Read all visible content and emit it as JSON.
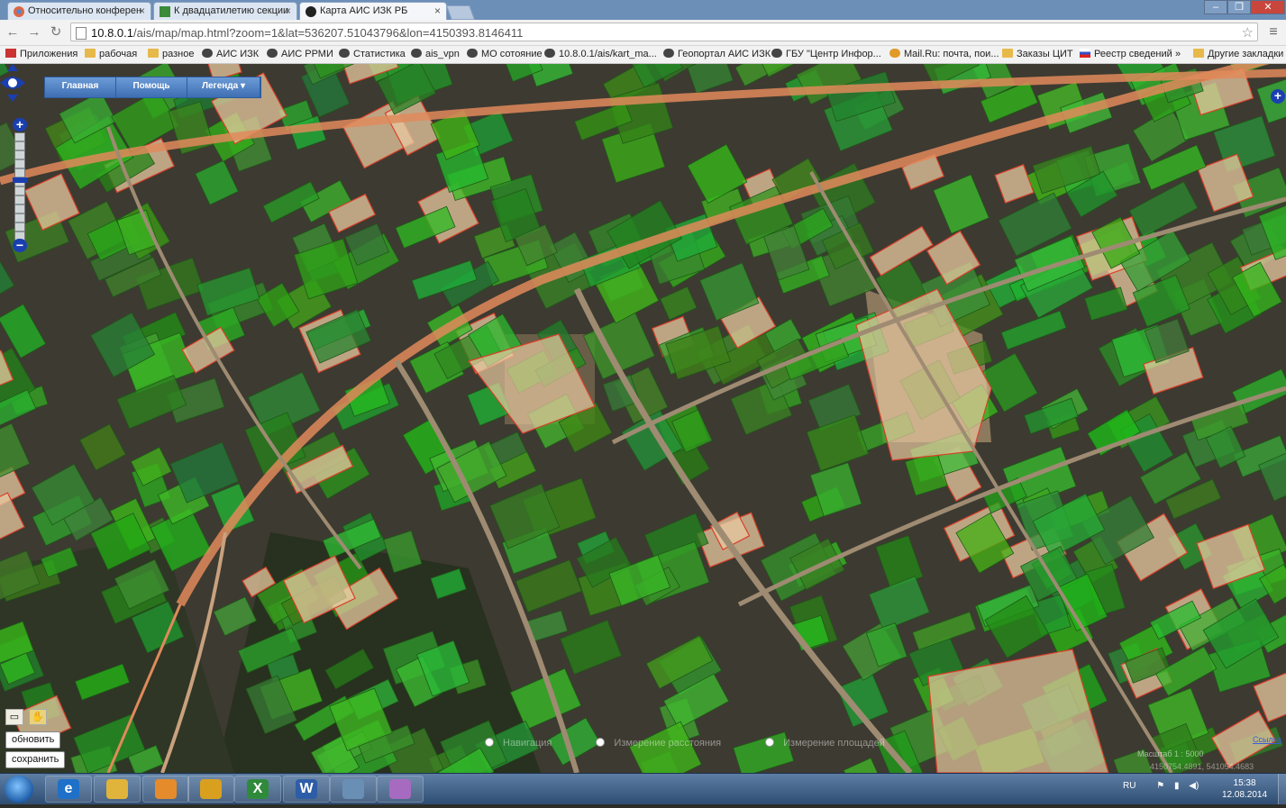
{
  "browser": {
    "tabs": [
      {
        "label": "Относительно конферен"
      },
      {
        "label": "К двадцатилетию секции"
      },
      {
        "label": "Карта АИС ИЗК РБ"
      }
    ],
    "url_host": "10.8.0.1",
    "url_path": "/ais/map/map.html?zoom=1&lat=536207.51043796&lon=4150393.8146411",
    "bookmarks": [
      {
        "label": "Приложения",
        "icon": "apps-icon"
      },
      {
        "label": "рабочая",
        "icon": "folder-icon"
      },
      {
        "label": "разное",
        "icon": "folder-icon"
      },
      {
        "label": "АИС ИЗК",
        "icon": "page-icon"
      },
      {
        "label": "АИС РРМИ",
        "icon": "page-icon"
      },
      {
        "label": "Статистика",
        "icon": "page-icon"
      },
      {
        "label": "ais_vpn",
        "icon": "page-icon"
      },
      {
        "label": "МО сотоя­ние",
        "icon": "page-icon"
      },
      {
        "label": "10.8.0.1/ais/kart_ma...",
        "icon": "page-icon"
      },
      {
        "label": "Геопортал АИС ИЗК",
        "icon": "page-icon"
      },
      {
        "label": "ГБУ \"Центр Инфор...",
        "icon": "page-icon"
      },
      {
        "label": "Mail.Ru: почта, пои...",
        "icon": "mail-icon"
      },
      {
        "label": "Заказы ЦИТ",
        "icon": "folder-icon"
      },
      {
        "label": "Реестр сведений",
        "icon": "flag-icon"
      },
      {
        "label": "»",
        "icon": ""
      },
      {
        "label": "Другие закладки",
        "icon": "folder-icon"
      }
    ]
  },
  "map": {
    "menu": [
      {
        "label": "Главная"
      },
      {
        "label": "Помощь"
      },
      {
        "label": "Легенда"
      }
    ],
    "buttons": {
      "refresh": "обновить",
      "save": "сохранить"
    },
    "modes": [
      {
        "label": "Навигация"
      },
      {
        "label": "Измерение расстояния"
      },
      {
        "label": "Измерение площадей"
      }
    ],
    "scale_text": "Масштаб 1 : 5000",
    "coords_text": "4150754.4891, 541054.4683",
    "credits": "Ссылка",
    "colors": {
      "parcel_green": "#2fa52a",
      "parcel_tan": "#e8c9a0",
      "road": "#e08a5a",
      "boundary": "#d9402a"
    }
  },
  "taskbar": {
    "apps": [
      "ie-icon",
      "explorer-icon",
      "media-player-icon",
      "chrome-icon",
      "excel-icon",
      "word-icon",
      "window-icon",
      "paint-icon"
    ],
    "app_letters": [
      "e",
      "",
      "",
      "",
      "X",
      "W",
      "",
      ""
    ],
    "lang": "RU",
    "time": "15:38",
    "date": "12.08.2014"
  }
}
